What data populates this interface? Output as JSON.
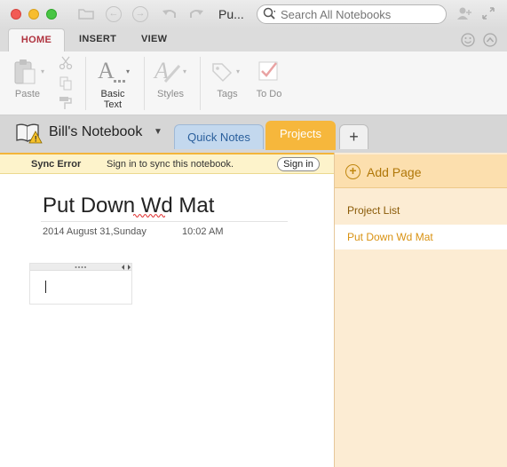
{
  "window": {
    "title": "Pu..."
  },
  "search": {
    "placeholder": "Search All Notebooks"
  },
  "ribbon": {
    "tabs": [
      {
        "label": "HOME",
        "active": true
      },
      {
        "label": "INSERT",
        "active": false
      },
      {
        "label": "VIEW",
        "active": false
      }
    ],
    "groups": {
      "paste_label": "Paste",
      "basic_text_label": "Basic\nText",
      "styles_label": "Styles",
      "tags_label": "Tags",
      "todo_label": "To Do"
    }
  },
  "notebook": {
    "name": "Bill's Notebook",
    "sections": [
      {
        "label": "Quick Notes",
        "active": false
      },
      {
        "label": "Projects",
        "active": true
      }
    ],
    "add_section_label": "+"
  },
  "sync": {
    "error_label": "Sync Error",
    "message": "Sign in to sync this notebook.",
    "signin_label": "Sign in"
  },
  "page": {
    "title": "Put Down Wd Mat",
    "date": "2014 August 31,Sunday",
    "time": "10:02 AM"
  },
  "pages_panel": {
    "add_page_label": "Add Page",
    "items": [
      {
        "label": "Project List",
        "selected": false
      },
      {
        "label": "Put Down Wd Mat",
        "selected": true
      }
    ]
  },
  "colors": {
    "accent_orange": "#f6b73c",
    "home_tab_red": "#b0333f",
    "quick_notes_blue": "#c3d8ee"
  }
}
